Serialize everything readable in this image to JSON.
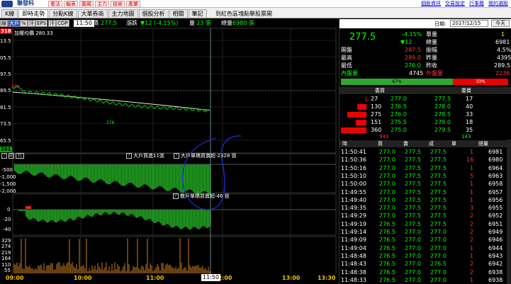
{
  "app": {
    "brand": "聯發科",
    "nav": [
      "看法",
      "報表",
      "籌碼",
      "主力",
      "技術",
      "產業"
    ],
    "links": [
      "個股資訊",
      "交易設定",
      "行事曆",
      "我的選股"
    ]
  },
  "tabs": [
    {
      "label": "K線",
      "active": false
    },
    {
      "label": "即時走勢",
      "active": true
    },
    {
      "label": "分點K線",
      "active": false
    },
    {
      "label": "大單券商",
      "active": false
    },
    {
      "label": "主力地圖",
      "active": false
    },
    {
      "label": "個股分析",
      "active": false
    },
    {
      "label": "相關",
      "active": false
    },
    {
      "label": "筆記",
      "active": false
    }
  ],
  "stock_title": "到紅色區塊點擊股票開",
  "toolbar": {
    "buttons": [
      "線",
      "大戶",
      "%",
      "汗",
      "EPS",
      "汗",
      "CDP"
    ],
    "time": "11:50",
    "price_label": "價",
    "price": "277.5",
    "change_label": "漲跌",
    "change": "▼12 (-4.15%)",
    "volume_label": "量",
    "volume": "23 張",
    "total_label": "總量",
    "total": "6980 張"
  },
  "axis": {
    "top_badge": "318",
    "price_ticks": [
      "13.5",
      "05.5",
      "97.5",
      "89.5",
      "81.5",
      "73.5",
      "65.5"
    ],
    "bottom_badge": "261",
    "ref_label": "289",
    "low_label": "276",
    "avg_label": "加權均價 280.33",
    "big_ticks": [
      "-500",
      "-1,000",
      "-1,500",
      "-2,000"
    ],
    "cum_ticks": [
      "0",
      "-20",
      "-40"
    ],
    "vol_ticks": [
      "329",
      "274",
      "219",
      "164",
      "110",
      "55"
    ]
  },
  "panels": {
    "big_header": [
      "?",
      "設",
      "柱"
    ],
    "big_label_a": "大戶買進11張",
    "big_label_b": "大戶單積買賣超-2328 張",
    "cum_label": "散戶單積買賣超-46 張"
  },
  "time_axis": [
    "09:00",
    "10:00",
    "11:00",
    "12:00",
    "13:00",
    "13:30"
  ],
  "cursor_time": "11:50",
  "quote": {
    "date_label": "日期:",
    "date": "2017/12/15",
    "today": "今天",
    "price": "277.5",
    "pct": "-4.15%",
    "chg": "▼12",
    "unit_label": "單量",
    "unit_val": "1",
    "total_label": "總量",
    "total_val": "6981",
    "rows": [
      {
        "l1": "開盤",
        "v1": "287.5",
        "l2": "振幅",
        "v2": "4.5%"
      },
      {
        "l1": "最高",
        "v1": "289.0",
        "l2": "昨量",
        "v2": "4395"
      },
      {
        "l1": "最低",
        "v1": "276.0",
        "l2": "昨收",
        "v2": "289.5"
      }
    ],
    "inner_label": "內盤量",
    "inner_val": "4745",
    "outer_label": "外盤量",
    "outer_val": "2236",
    "buy_pct": "67%",
    "sell_pct": "33%",
    "buy_ratio": 0.67
  },
  "orderbook": {
    "buy_header": "委買",
    "sell_header": "委賣",
    "rows": [
      {
        "bq": "27",
        "bp": "277.0",
        "sp": "277.5",
        "sq": "17",
        "bar": 0.03
      },
      {
        "bq": "130",
        "bp": "276.5",
        "sp": "278.0",
        "sq": "40",
        "bar": 0.35
      },
      {
        "bq": "275",
        "bp": "276.0",
        "sp": "278.5",
        "sq": "33",
        "bar": 0.76
      },
      {
        "bq": "151",
        "bp": "275.5",
        "sp": "279.0",
        "sq": "18",
        "bar": 0.42
      },
      {
        "bq": "360",
        "bp": "275.0",
        "sp": "279.5",
        "sq": "35",
        "bar": 1.0
      }
    ],
    "buy_total": "943",
    "sell_total": "143"
  },
  "trades": {
    "headers": [
      "時",
      "買",
      "賣",
      "成",
      "單",
      "總量"
    ],
    "rows": [
      {
        "t": "11:50:41",
        "b": "277.0",
        "s": "277.5",
        "p": "277.5",
        "u": "1",
        "v": "6981"
      },
      {
        "t": "11:50:36",
        "b": "277.0",
        "s": "277.5",
        "p": "277.5",
        "u": "16",
        "v": "6980"
      },
      {
        "t": "11:50:16",
        "b": "277.0",
        "s": "277.5",
        "p": "277.5",
        "u": "1",
        "v": "6964"
      },
      {
        "t": "11:50:10",
        "b": "277.0",
        "s": "277.5",
        "p": "277.5",
        "u": "5",
        "v": "6963"
      },
      {
        "t": "11:50:00",
        "b": "277.0",
        "s": "277.5",
        "p": "277.5",
        "u": "1",
        "v": "6958"
      },
      {
        "t": "11:49:55",
        "b": "277.0",
        "s": "277.5",
        "p": "277.5",
        "u": "1",
        "v": "6957"
      },
      {
        "t": "11:49:40",
        "b": "277.0",
        "s": "277.5",
        "p": "277.5",
        "u": "1",
        "v": "6956"
      },
      {
        "t": "11:49:35",
        "b": "277.0",
        "s": "277.5",
        "p": "277.5",
        "u": "3",
        "v": "6955"
      },
      {
        "t": "11:49:29",
        "b": "277.0",
        "s": "277.5",
        "p": "277.5",
        "u": "2",
        "v": "6952"
      },
      {
        "t": "11:49:19",
        "b": "276.5",
        "s": "277.5",
        "p": "277.5",
        "u": "2",
        "v": "6951"
      },
      {
        "t": "11:49:14",
        "b": "276.5",
        "s": "277.0",
        "p": "277.0",
        "u": "2",
        "v": "6949"
      },
      {
        "t": "11:49:09",
        "b": "276.5",
        "s": "277.0",
        "p": "277.0",
        "u": "2",
        "v": "6946"
      },
      {
        "t": "11:49:04",
        "b": "276.5",
        "s": "277.0",
        "p": "277.0",
        "u": "1",
        "v": "6944"
      },
      {
        "t": "11:48:48",
        "b": "276.5",
        "s": "277.0",
        "p": "277.0",
        "u": "1",
        "v": "6943"
      },
      {
        "t": "11:48:43",
        "b": "276.5",
        "s": "277.0",
        "p": "276.5",
        "u": "2",
        "v": "6942"
      },
      {
        "t": "11:48:38",
        "b": "276.5",
        "s": "277.0",
        "p": "277.0",
        "u": "2",
        "v": "6938"
      },
      {
        "t": "11:48:33",
        "b": "276.5",
        "s": "277.0",
        "p": "277.0",
        "u": "1",
        "v": "6938"
      }
    ]
  },
  "colors": {
    "up": "#ff3333",
    "down": "#00ff00",
    "bar_green": "#22aa22",
    "vol": "#d08020",
    "annotation": "#1a2fd0"
  }
}
